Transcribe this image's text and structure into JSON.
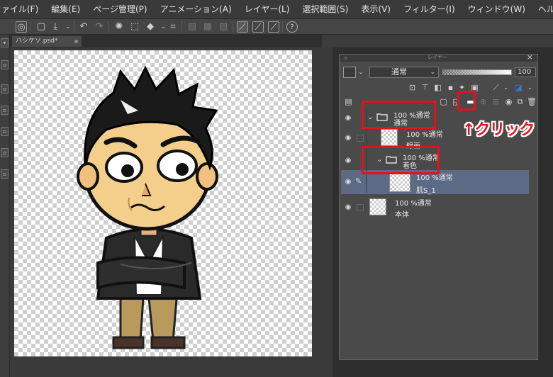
{
  "menu": [
    "ァイル(F)",
    "編集(E)",
    "ページ管理(P)",
    "アニメーション(A)",
    "レイヤー(L)",
    "選択範囲(S)",
    "表示(V)",
    "フィルター(I)",
    "ウィンドウ(W)",
    "ヘルプ(H)"
  ],
  "document_tab": "ハシケソ.psd*",
  "panel": {
    "title": "レイヤー",
    "close": "×",
    "blend_mode": "通常",
    "opacity": "100"
  },
  "layers": [
    {
      "opacity_mode": "100 %通常",
      "name": "通常",
      "type": "folder"
    },
    {
      "opacity_mode": "100 %通常",
      "name": "線画",
      "type": "raster"
    },
    {
      "opacity_mode": "100 %通常",
      "name": "着色",
      "type": "folder"
    },
    {
      "opacity_mode": "100 %通常",
      "name": "肌S_1",
      "type": "raster",
      "selected": true
    },
    {
      "opacity_mode": "100 %通常",
      "name": "本体",
      "type": "raster"
    }
  ],
  "annotation": "↑クリック",
  "colors": {
    "highlight": "#e0141e",
    "selected_row": "#5d6a86"
  }
}
